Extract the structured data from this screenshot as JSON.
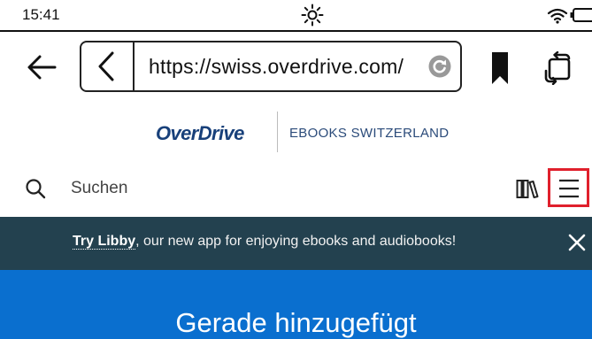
{
  "status_bar": {
    "time": "15:41"
  },
  "browser": {
    "url": "https://swiss.overdrive.com/"
  },
  "header": {
    "logo_text": "OverDrive",
    "library_name": "EBOOKS SWITZERLAND"
  },
  "search": {
    "placeholder": "Suchen"
  },
  "banner": {
    "link_text": "Try Libby",
    "message_text": ", our new app for enjoying ebooks and audiobooks!"
  },
  "hero": {
    "heading": "Gerade hinzugefügt"
  },
  "colors": {
    "brand_blue": "#18407a",
    "banner_bg": "#23414f",
    "hero_bg": "#0a6fcf",
    "highlight_red": "#e0202c"
  },
  "icons": {
    "status": [
      "sun-icon",
      "wifi-icon",
      "battery-icon"
    ],
    "toolbar": [
      "arrow-left-icon",
      "chevron-left-icon",
      "reload-icon",
      "bookmark-icon",
      "rotate-screen-icon"
    ],
    "search_row": [
      "search-icon",
      "library-shelf-icon",
      "hamburger-menu-icon"
    ],
    "banner": [
      "close-icon"
    ]
  }
}
